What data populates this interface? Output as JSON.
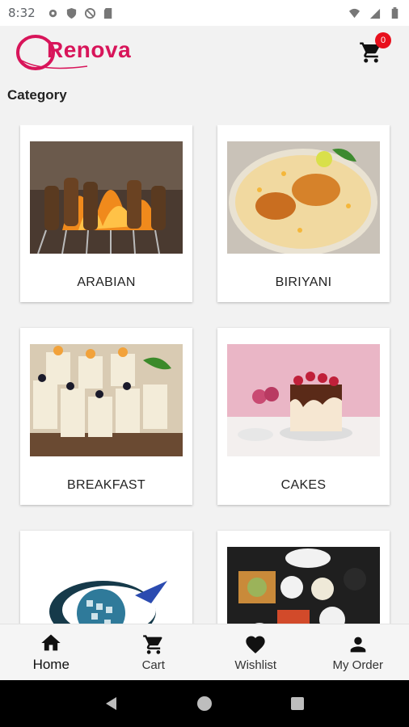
{
  "status": {
    "time": "8:32"
  },
  "app": {
    "brand": "Renova",
    "cart_count": "0"
  },
  "section": {
    "title": "Category"
  },
  "categories": [
    {
      "label": "ARABIAN"
    },
    {
      "label": "BIRIYANI"
    },
    {
      "label": "BREAKFAST"
    },
    {
      "label": "CAKES"
    },
    {
      "label": ""
    },
    {
      "label": ""
    }
  ],
  "nav": [
    {
      "label": "Home",
      "icon": "home-icon"
    },
    {
      "label": "Cart",
      "icon": "cart-icon"
    },
    {
      "label": "Wishlist",
      "icon": "heart-icon"
    },
    {
      "label": "My Order",
      "icon": "person-icon"
    }
  ],
  "colors": {
    "brand": "#d8155a",
    "badge": "#e8101d"
  }
}
